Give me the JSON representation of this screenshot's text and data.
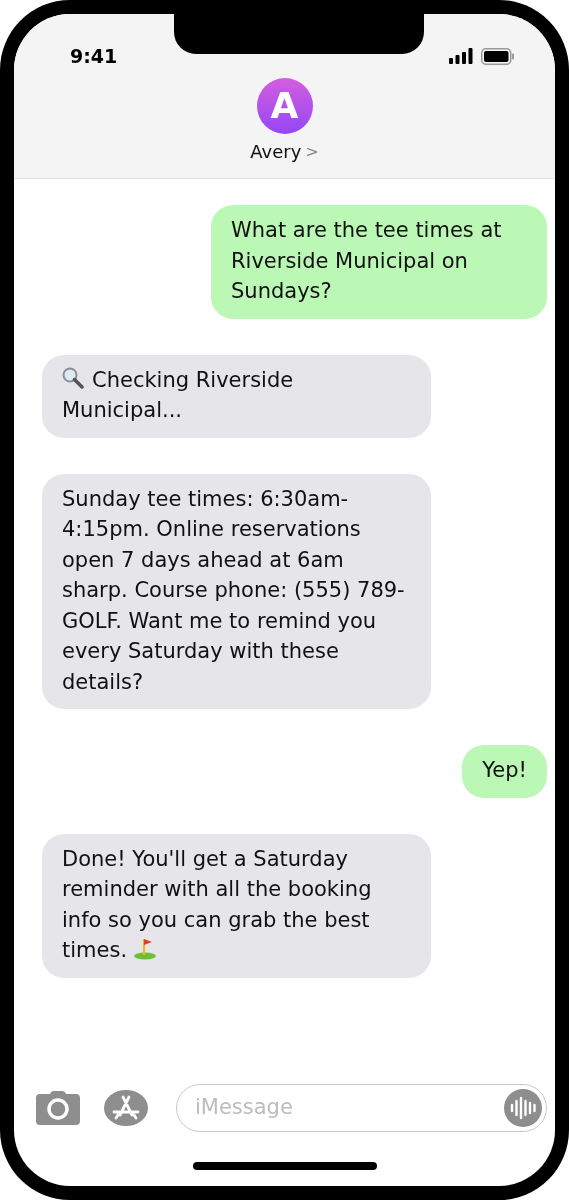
{
  "status_bar": {
    "time": "9:41"
  },
  "contact": {
    "initial": "A",
    "name": "Avery",
    "chevron": ">"
  },
  "messages": [
    {
      "kind": "sent",
      "text": "What are the tee times at Riverside Municipal on Sundays?"
    },
    {
      "kind": "searching",
      "text": "Checking Riverside Municipal..."
    },
    {
      "kind": "received",
      "text": "Sunday tee times: 6:30am-4:15pm. Online reservations open 7 days ahead at 6am sharp. Course phone: (555) 789-GOLF. Want me to remind you every Saturday with these details?"
    },
    {
      "kind": "sent",
      "text": "Yep!"
    },
    {
      "kind": "golf",
      "text": "Done! You'll get a Saturday reminder with all the booking info so you can grab the best times."
    }
  ],
  "composer": {
    "placeholder": "iMessage"
  }
}
